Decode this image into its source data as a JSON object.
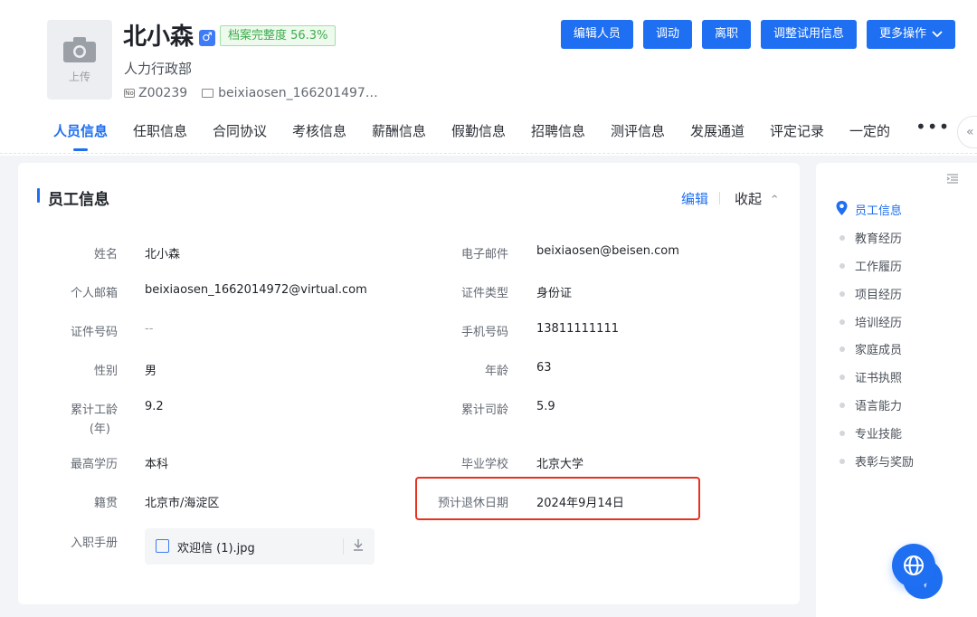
{
  "profile": {
    "avatar_upload_label": "上传",
    "name": "北小森",
    "gender_symbol": "♂",
    "completeness": "档案完整度 56.3%",
    "department": "人力行政部",
    "employee_id": "Z00239",
    "email_short": "beixiaosen_166201497…"
  },
  "actions": {
    "edit": "编辑人员",
    "transfer": "调动",
    "resign": "离职",
    "adjust_probation": "调整试用信息",
    "more": "更多操作"
  },
  "tabs": [
    "人员信息",
    "任职信息",
    "合同协议",
    "考核信息",
    "薪酬信息",
    "假勤信息",
    "招聘信息",
    "测评信息",
    "发展通道",
    "评定记录",
    "一定的"
  ],
  "tab_more": "•••",
  "collapse_tab_icon": "«",
  "section": {
    "title": "员工信息",
    "edit": "编辑",
    "collapse": "收起",
    "collapse_icon": "⌃"
  },
  "fields": {
    "name_label": "姓名",
    "name_value": "北小森",
    "email_label": "电子邮件",
    "email_value": "beixiaosen@beisen.com",
    "personal_email_label": "个人邮箱",
    "personal_email_value": "beixiaosen_1662014972@virtual.com",
    "id_type_label": "证件类型",
    "id_type_value": "身份证",
    "id_number_label": "证件号码",
    "id_number_value": "--",
    "mobile_label": "手机号码",
    "mobile_value": "13811111111",
    "gender_label": "性别",
    "gender_value": "男",
    "age_label": "年龄",
    "age_value": "63",
    "work_years_label_1": "累计工龄",
    "work_years_label_2": "(年)",
    "work_years_value": "9.2",
    "company_years_label": "累计司龄",
    "company_years_value": "5.9",
    "education_label": "最高学历",
    "education_value": "本科",
    "school_label": "毕业学校",
    "school_value": "北京大学",
    "native_place_label": "籍贯",
    "native_place_value": "北京市/海淀区",
    "retire_date_label": "预计退休日期",
    "retire_date_value": "2024年9月14日",
    "onboard_manual_label": "入职手册",
    "onboard_manual_file": "欢迎信 (1).jpg"
  },
  "sidebar": {
    "anchors": [
      "员工信息",
      "教育经历",
      "工作履历",
      "项目经历",
      "培训经历",
      "家庭成员",
      "证书执照",
      "语言能力",
      "专业技能",
      "表彰与奖励"
    ],
    "active_index": 0
  },
  "colors": {
    "primary": "#1e6ff1",
    "highlight_border": "#e8311e",
    "completeness_text": "#3cad4b"
  }
}
